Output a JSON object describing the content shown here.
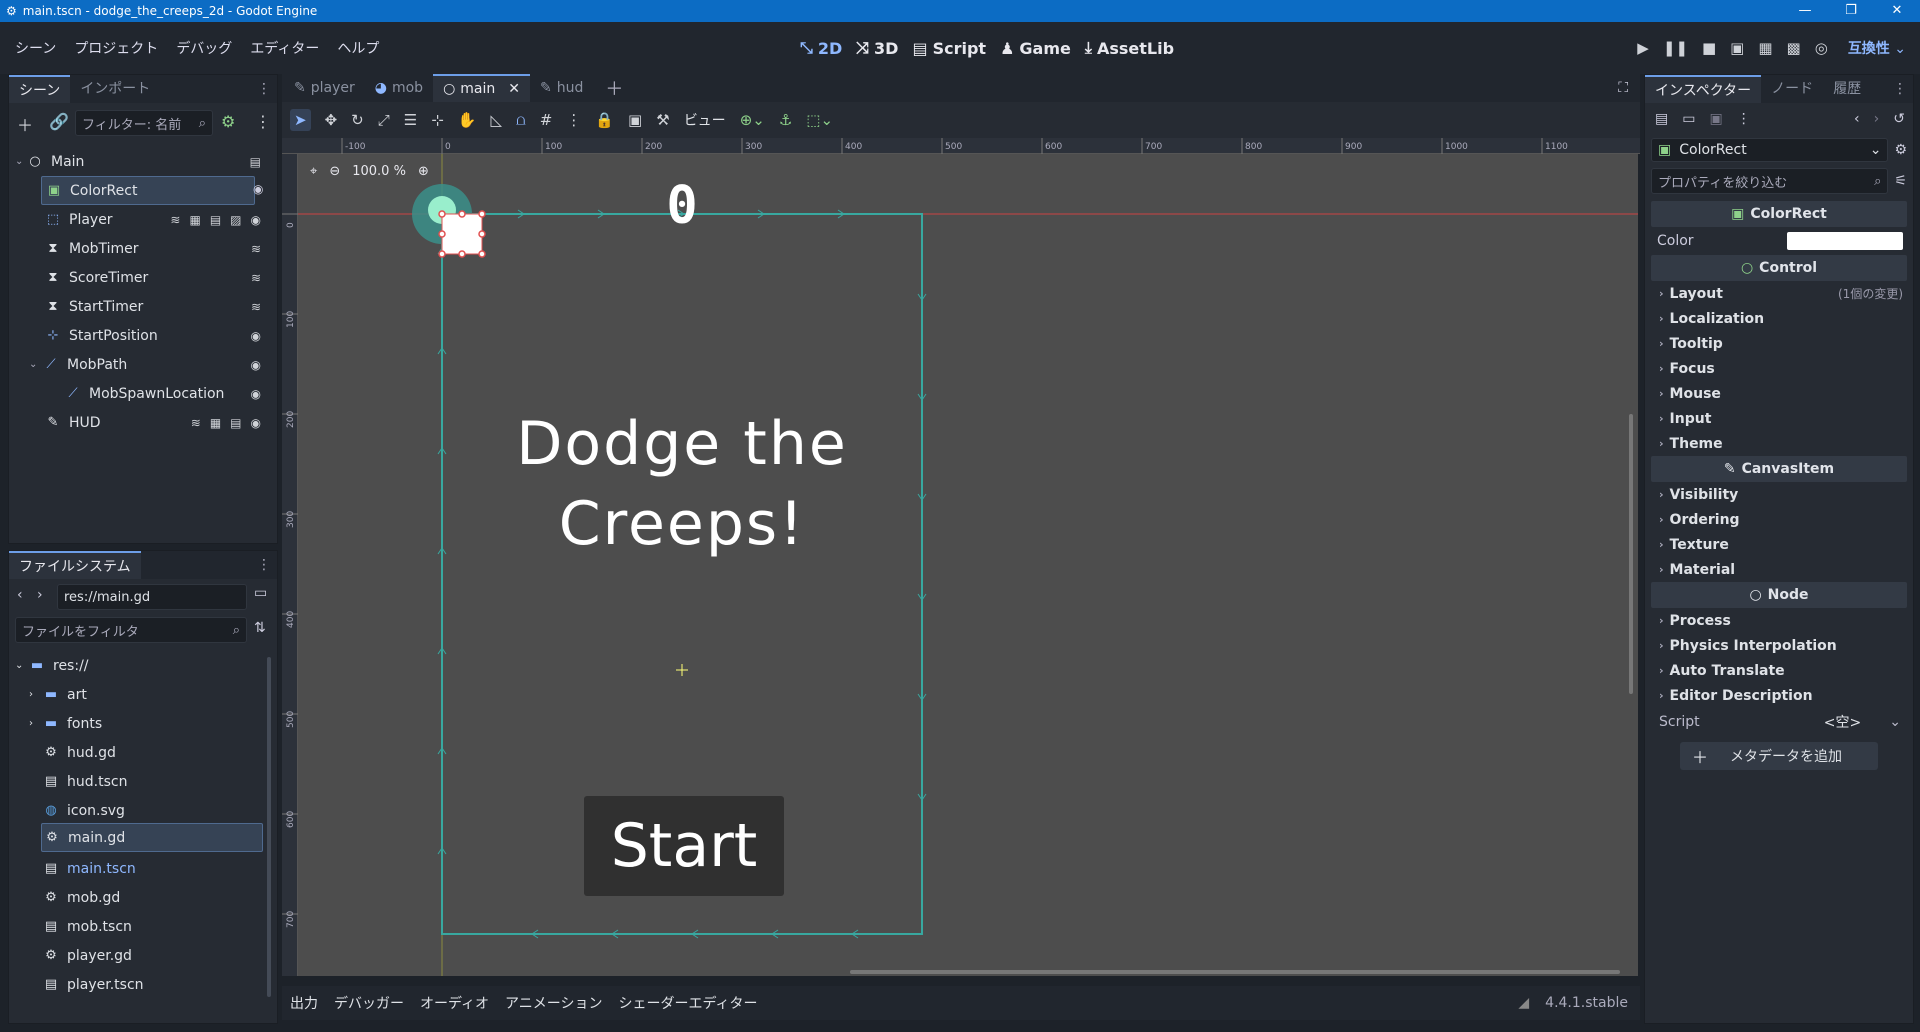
{
  "window": {
    "title": "main.tscn - dodge_the_creeps_2d - Godot Engine"
  },
  "menu": {
    "items": [
      "シーン",
      "プロジェクト",
      "デバッグ",
      "エディター",
      "ヘルプ"
    ]
  },
  "main_screens": {
    "d2": "2D",
    "d3": "3D",
    "script": "Script",
    "game": "Game",
    "assetlib": "AssetLib"
  },
  "compat": "互換性",
  "scene_dock": {
    "tabs": [
      "シーン",
      "インポート"
    ],
    "filter_placeholder": "フィルター: 名前",
    "nodes": [
      {
        "label": "Main",
        "icon": "node-icon"
      },
      {
        "label": "ColorRect",
        "icon": "colorrect-icon"
      },
      {
        "label": "Player",
        "icon": "area2d-icon"
      },
      {
        "label": "MobTimer",
        "icon": "timer-icon"
      },
      {
        "label": "ScoreTimer",
        "icon": "timer-icon"
      },
      {
        "label": "StartTimer",
        "icon": "timer-icon"
      },
      {
        "label": "StartPosition",
        "icon": "marker2d-icon"
      },
      {
        "label": "MobPath",
        "icon": "path2d-icon"
      },
      {
        "label": "MobSpawnLocation",
        "icon": "pathfollow-icon"
      },
      {
        "label": "HUD",
        "icon": "canvaslayer-icon"
      }
    ]
  },
  "filesystem": {
    "tab": "ファイルシステム",
    "path": "res://main.gd",
    "filter_placeholder": "ファイルをフィルタ",
    "items": [
      "res://",
      "art",
      "fonts",
      "hud.gd",
      "hud.tscn",
      "icon.svg",
      "main.gd",
      "main.tscn",
      "mob.gd",
      "mob.tscn",
      "player.gd",
      "player.tscn"
    ]
  },
  "editor_tabs": [
    "player",
    "mob",
    "main",
    "hud"
  ],
  "toolbar": {
    "view_label": "ビュー"
  },
  "viewport": {
    "zoom": "100.0 %",
    "score": "0",
    "message_line1": "Dodge the",
    "message_line2": "Creeps!",
    "start_button": "Start",
    "ruler_labels": [
      "-100",
      "0",
      "100",
      "200",
      "300",
      "400",
      "500",
      "600",
      "700",
      "800",
      "900",
      "1000",
      "1100"
    ],
    "vruler_labels": [
      "0",
      "100",
      "200",
      "300",
      "400",
      "500",
      "600",
      "700"
    ]
  },
  "bottom_panel": {
    "tabs": [
      "出力",
      "デバッガー",
      "オーディオ",
      "アニメーション",
      "シェーダーエディター"
    ],
    "version": "4.4.1.stable"
  },
  "inspector": {
    "tabs": [
      "インスペクター",
      "ノード",
      "履歴"
    ],
    "object": "ColorRect",
    "filter_placeholder": "プロパティを絞り込む",
    "class_header": "ColorRect",
    "color_label": "Color",
    "control_header": "Control",
    "control_rows": [
      "Layout",
      "Localization",
      "Tooltip",
      "Focus",
      "Mouse",
      "Input",
      "Theme"
    ],
    "layout_note": "(1個の変更)",
    "canvasitem_header": "CanvasItem",
    "canvasitem_rows": [
      "Visibility",
      "Ordering",
      "Texture",
      "Material"
    ],
    "node_header": "Node",
    "node_rows": [
      "Process",
      "Physics Interpolation",
      "Auto Translate",
      "Editor Description"
    ],
    "script_label": "Script",
    "script_value": "<空>",
    "add_metadata": "メタデータを追加"
  },
  "colors": {
    "accent": "#6d9ee8",
    "path": "#38a8a0",
    "viewport_bg": "#4d4d4d"
  }
}
